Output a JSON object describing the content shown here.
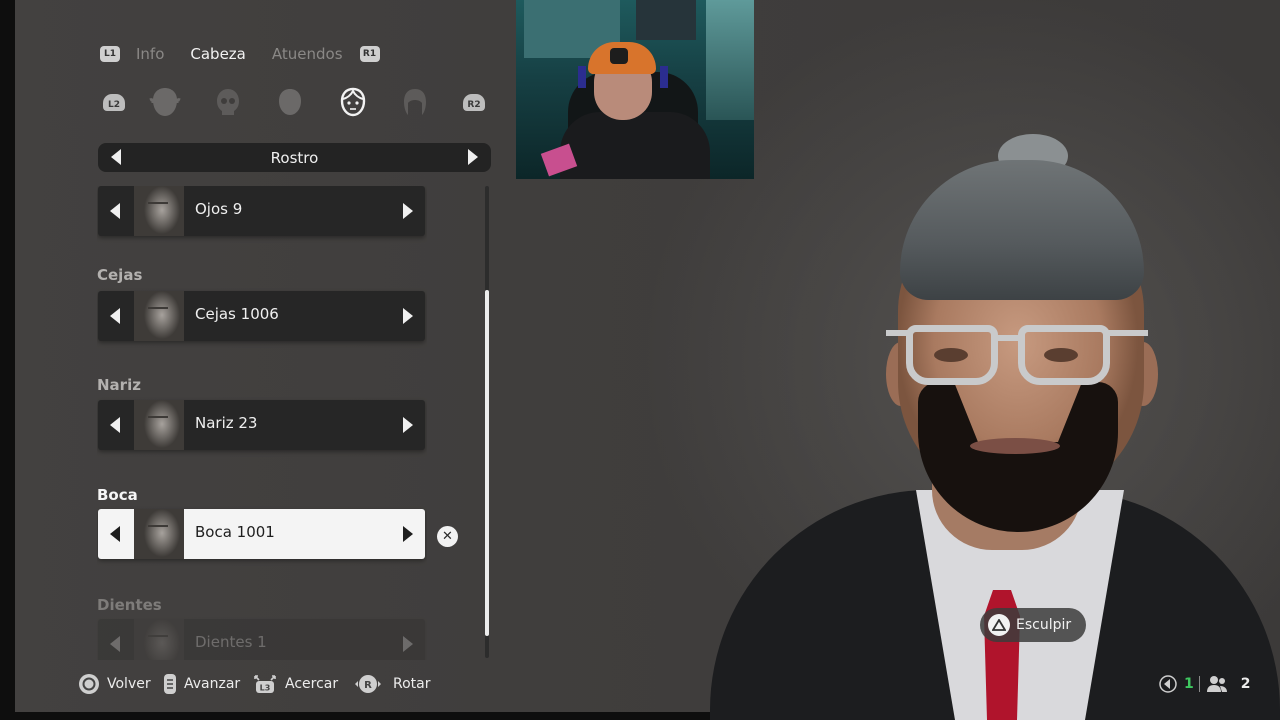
{
  "tabs": {
    "left_badge": "L1",
    "items": [
      "Info",
      "Cabeza",
      "Atuendos"
    ],
    "active_index": 1,
    "right_badge": "R1"
  },
  "categories": {
    "left_badge": "L2",
    "right_badge": "R2",
    "icons": [
      "head-full-icon",
      "skull-icon",
      "head-shape-icon",
      "face-icon",
      "hair-icon"
    ],
    "active_index": 3
  },
  "selector": {
    "label": "Rostro"
  },
  "sections": [
    {
      "title": "",
      "value": "Ojos 9"
    },
    {
      "title": "Cejas",
      "value": "Cejas 1006"
    },
    {
      "title": "Nariz",
      "value": "Nariz 23"
    },
    {
      "title": "Boca",
      "value": "Boca 1001"
    },
    {
      "title": "Dientes",
      "value": "Dientes 1"
    }
  ],
  "selected_section": "Boca",
  "clear_symbol": "✕",
  "character": {
    "sculpt_label": "Esculpir"
  },
  "footer": {
    "back": "Volver",
    "next": "Avanzar",
    "zoom": "Acercar",
    "rotate": "Rotar",
    "zoom_badge": "L3",
    "rotate_badge": "R"
  },
  "status": {
    "count_a": "1",
    "count_b": "2"
  },
  "colors": {
    "accent_green": "#3fc860",
    "tie_red": "#b0142c"
  }
}
